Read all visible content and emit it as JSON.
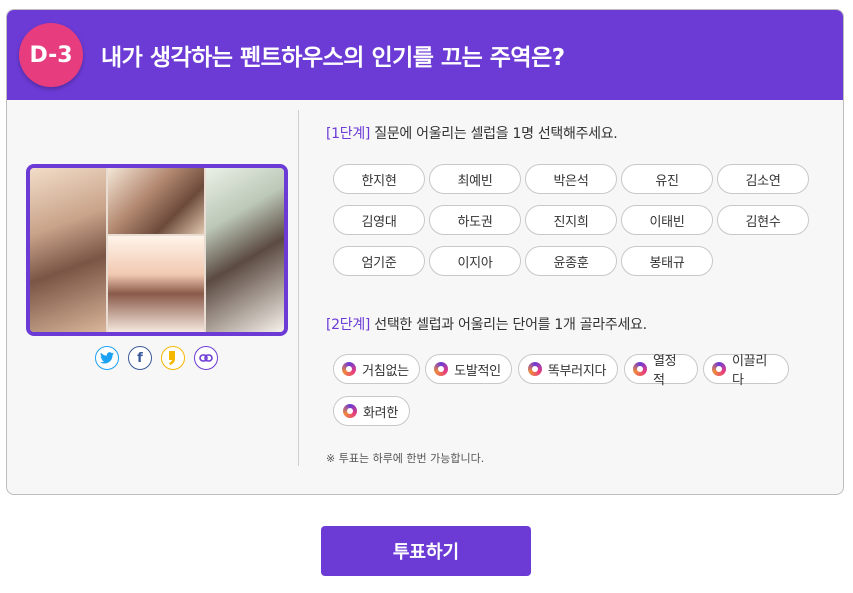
{
  "header": {
    "badge": "D-3",
    "title": "내가 생각하는 펜트하우스의 인기를 끄는 주역은?"
  },
  "image": {
    "description_icon": "drama-photo-collage"
  },
  "share": {
    "twitter": "twitter-icon",
    "facebook": "f",
    "kakaostory": "kakaostory-icon",
    "link": "link-icon"
  },
  "step1": {
    "tag": "[1단계]",
    "text": " 질문에 어울리는 셀럽을 1명 선택해주세요.",
    "celebs": [
      "한지현",
      "최예빈",
      "박은석",
      "유진",
      "김소연",
      "김영대",
      "하도권",
      "진지희",
      "이태빈",
      "김현수",
      "엄기준",
      "이지아",
      "윤종훈",
      "봉태규"
    ]
  },
  "step2": {
    "tag": "[2단계]",
    "text": " 선택한 셀럽과 어울리는 단어를 1개 골라주세요.",
    "words": [
      "거침없는",
      "도발적인",
      "똑부러지다",
      "열정적",
      "이끌리다",
      "화려한"
    ]
  },
  "note": "※ 투표는 하루에 한번 가능합니다.",
  "vote_button": "투표하기",
  "colors": {
    "primary": "#6c3bd6",
    "badge": "#e73d7e"
  }
}
